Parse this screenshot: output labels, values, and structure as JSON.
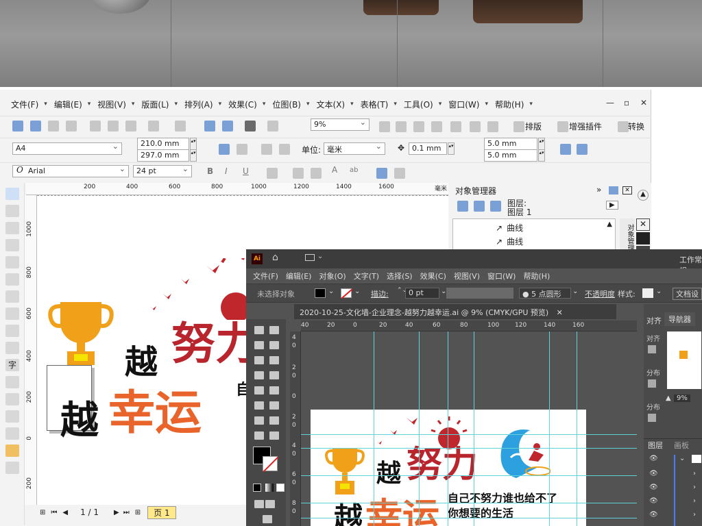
{
  "coreldraw": {
    "menu": [
      {
        "label": "文件(F)"
      },
      {
        "label": "编辑(E)"
      },
      {
        "label": "视图(V)"
      },
      {
        "label": "版面(L)"
      },
      {
        "label": "排列(A)"
      },
      {
        "label": "效果(C)"
      },
      {
        "label": "位图(B)"
      },
      {
        "label": "文本(X)"
      },
      {
        "label": "表格(T)"
      },
      {
        "label": "工具(O)"
      },
      {
        "label": "窗口(W)"
      },
      {
        "label": "帮助(H)"
      }
    ],
    "toolbar": {
      "zoom": "9%",
      "layout_label": "排版",
      "plugin_label": "增强插件",
      "convert_label": "转换"
    },
    "property_bar": {
      "page_size": "A4",
      "width": "210.0 mm",
      "height": "297.0 mm",
      "unit_label": "单位:",
      "unit": "毫米",
      "nudge": "0.1 mm",
      "dup_x": "5.0 mm",
      "dup_y": "5.0 mm"
    },
    "text_bar": {
      "font": "Arial",
      "size": "24 pt"
    },
    "ruler_h": [
      "200",
      "400",
      "600",
      "800",
      "1000",
      "1200",
      "1400",
      "1600",
      "毫米"
    ],
    "ruler_v": [
      "1000",
      "800",
      "600",
      "400",
      "200",
      "0",
      "200"
    ],
    "page_nav": {
      "counter": "1 / 1",
      "tab": "页 1"
    },
    "object_manager": {
      "title": "对象管理器",
      "layer_label": "图层:",
      "layer_name": "图层 1",
      "items": [
        "曲线",
        "曲线"
      ],
      "side_tab": "对象管理器"
    },
    "artwork": {
      "line1": "越",
      "line1b": "努力",
      "line2a": "越",
      "line2b": "幸运",
      "side_text": "自"
    }
  },
  "illustrator": {
    "app_badge": "Ai",
    "workspace": "工作常规",
    "menu": [
      "文件(F)",
      "编辑(E)",
      "对象(O)",
      "文字(T)",
      "选择(S)",
      "效果(C)",
      "视图(V)",
      "窗口(W)",
      "帮助(H)"
    ],
    "control": {
      "no_selection": "未选择对象",
      "stroke_label": "描边:",
      "stroke_value": "0 pt",
      "brush": "5 点圆形",
      "opacity": "不透明度",
      "style": "样式:",
      "doc_settings": "文档设"
    },
    "doc_tab": "2020-10-25-文化墙-企业理念-越努力越幸运.ai @ 9% (CMYK/GPU 预览)",
    "ruler_h": [
      "40",
      "20",
      "0",
      "20",
      "40",
      "60",
      "80",
      "100",
      "120",
      "140",
      "160"
    ],
    "ruler_v": [
      "4",
      "0",
      "2",
      "0",
      "0",
      "2",
      "0",
      "4",
      "0",
      "6",
      "0",
      "8",
      "0"
    ],
    "panels": {
      "navigator": "导航器",
      "align_tab": "对齐",
      "align": "对齐",
      "distribute1": "分布",
      "distribute2": "分布",
      "zoom": "9%",
      "layers": "图层",
      "artboards": "画板"
    },
    "artwork": {
      "line1a": "越",
      "line1b": "努力",
      "line2a": "越",
      "line2b": "幸运",
      "slogan1": "自己不努力谁也给不了",
      "slogan2": "你想要的生活"
    }
  },
  "colors": {
    "red": "#b8252c",
    "orange": "#e8642a",
    "gold": "#f0a019",
    "blue": "#2da0e0",
    "guide": "#5fd3d8"
  }
}
